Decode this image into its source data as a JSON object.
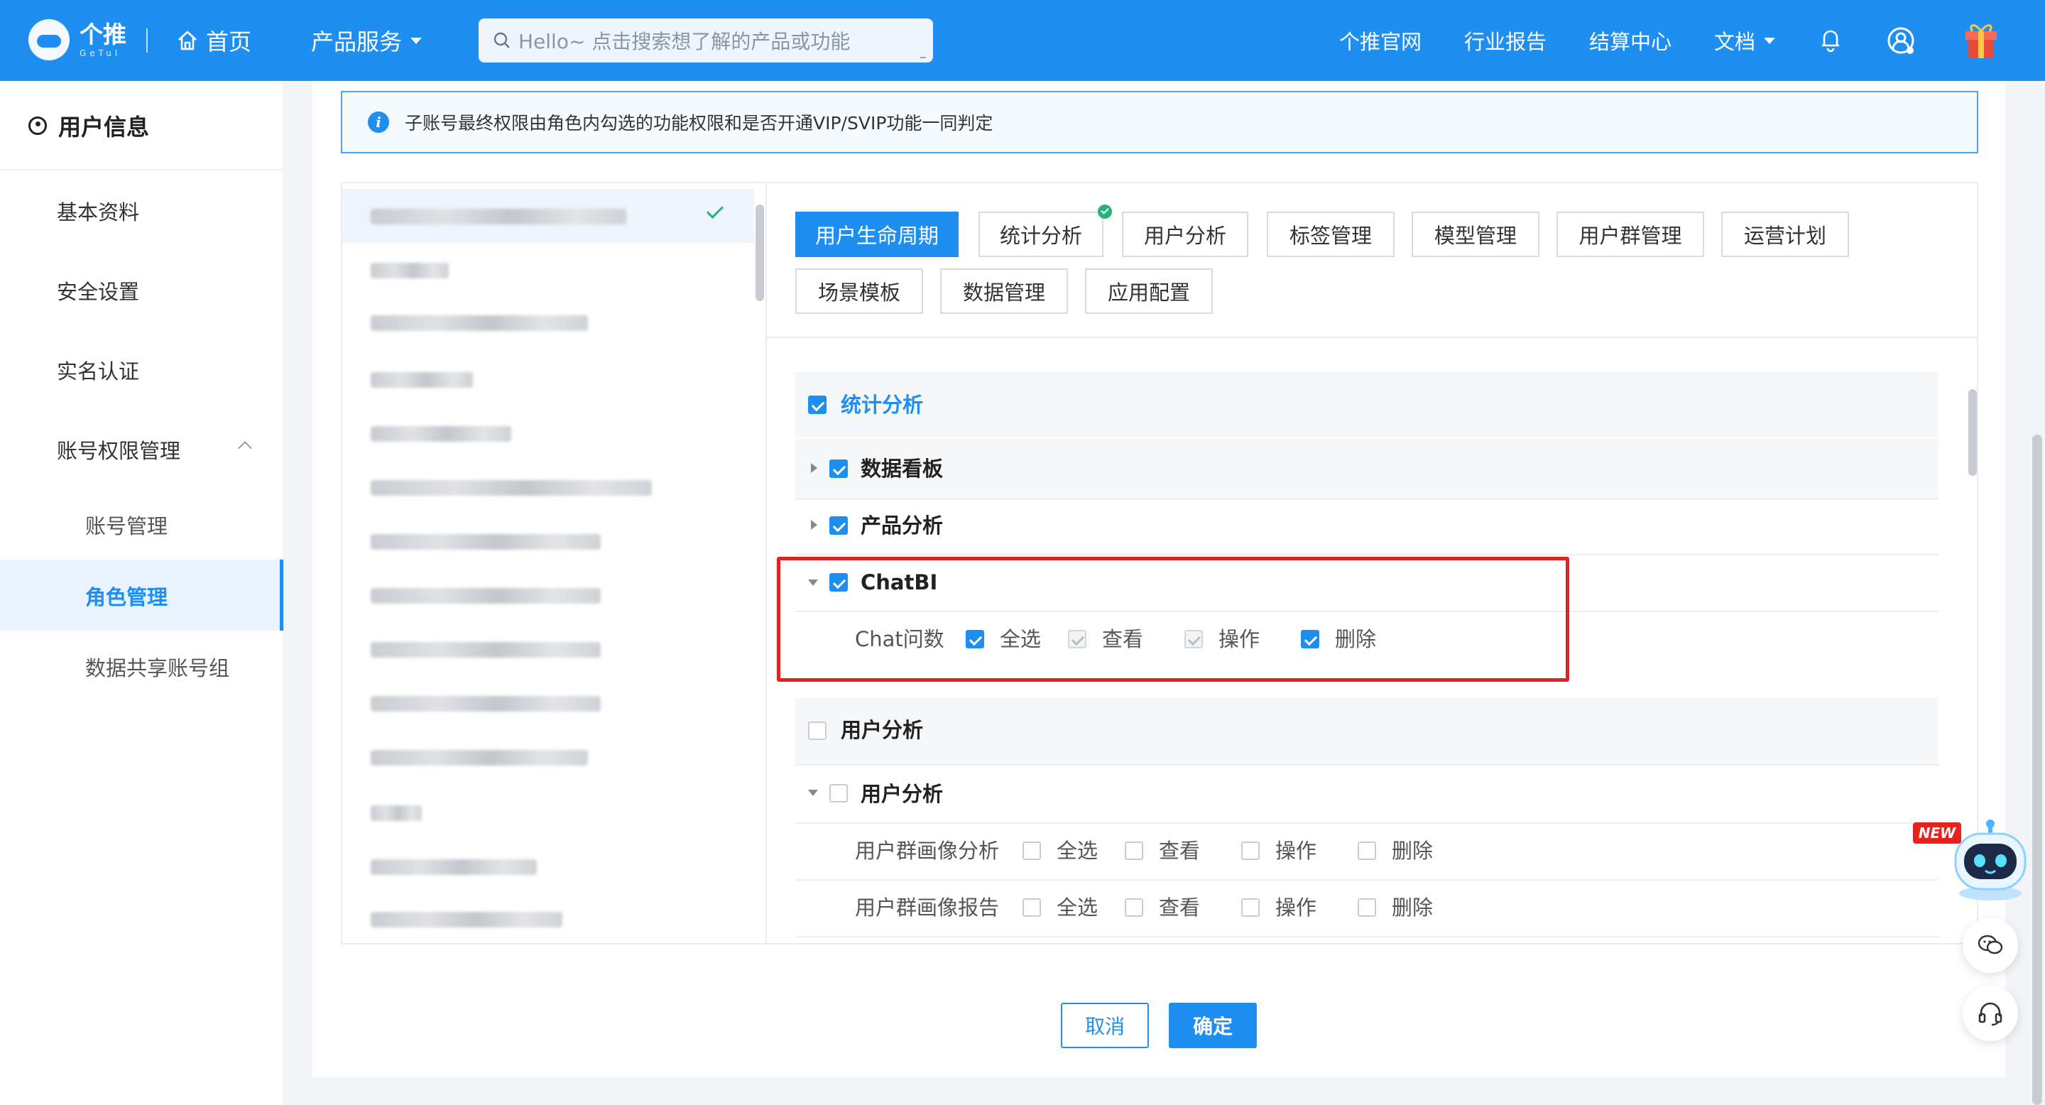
{
  "header": {
    "logo_text": "个推",
    "logo_sub": "GeTuI",
    "home_label": "首页",
    "products_label": "产品服务",
    "search_placeholder": "Hello~ 点击搜索想了解的产品或功能",
    "nav": [
      "个推官网",
      "行业报告",
      "结算中心",
      "文档"
    ],
    "accent": "#1f8ef1"
  },
  "sidebar": {
    "title": "用户信息",
    "items": [
      {
        "label": "基本资料"
      },
      {
        "label": "安全设置"
      },
      {
        "label": "实名认证"
      },
      {
        "label": "账号权限管理",
        "expanded": true
      }
    ],
    "sub_items": [
      {
        "label": "账号管理"
      },
      {
        "label": "角色管理",
        "active": true
      },
      {
        "label": "数据共享账号组"
      }
    ]
  },
  "notice": {
    "text": "子账号最终权限由角色内勾选的功能权限和是否开通VIP/SVIP功能一同判定"
  },
  "tabs": [
    {
      "label": "用户生命周期",
      "active": true
    },
    {
      "label": "统计分析",
      "has_check_badge": true
    },
    {
      "label": "用户分析"
    },
    {
      "label": "标签管理"
    },
    {
      "label": "模型管理"
    },
    {
      "label": "用户群管理"
    },
    {
      "label": "运营计划"
    },
    {
      "label": "场景模板"
    },
    {
      "label": "数据管理"
    },
    {
      "label": "应用配置"
    }
  ],
  "permissions": {
    "sections": [
      {
        "title": "统计分析",
        "checked": true,
        "groups": [
          {
            "label": "数据看板",
            "checked": true,
            "expanded": false
          },
          {
            "label": "产品分析",
            "checked": true,
            "expanded": false
          },
          {
            "label": "ChatBI",
            "checked": true,
            "expanded": true,
            "highlighted": true,
            "rows": [
              {
                "label": "Chat问数",
                "options": [
                  {
                    "label": "全选",
                    "state": "checked"
                  },
                  {
                    "label": "查看",
                    "state": "checked-disabled"
                  },
                  {
                    "label": "操作",
                    "state": "checked-disabled"
                  },
                  {
                    "label": "删除",
                    "state": "checked"
                  }
                ]
              }
            ]
          }
        ]
      },
      {
        "title": "用户分析",
        "checked": false,
        "groups": [
          {
            "label": "用户分析",
            "checked": false,
            "expanded": true,
            "rows": [
              {
                "label": "用户群画像分析",
                "options": [
                  {
                    "label": "全选",
                    "state": "unchecked"
                  },
                  {
                    "label": "查看",
                    "state": "unchecked"
                  },
                  {
                    "label": "操作",
                    "state": "unchecked"
                  },
                  {
                    "label": "删除",
                    "state": "unchecked"
                  }
                ]
              },
              {
                "label": "用户群画像报告",
                "options": [
                  {
                    "label": "全选",
                    "state": "unchecked"
                  },
                  {
                    "label": "查看",
                    "state": "unchecked"
                  },
                  {
                    "label": "操作",
                    "state": "unchecked"
                  },
                  {
                    "label": "删除",
                    "state": "unchecked"
                  }
                ]
              }
            ]
          }
        ]
      }
    ]
  },
  "footer": {
    "cancel_label": "取消",
    "confirm_label": "确定"
  },
  "widgets": {
    "new_badge": "NEW"
  }
}
